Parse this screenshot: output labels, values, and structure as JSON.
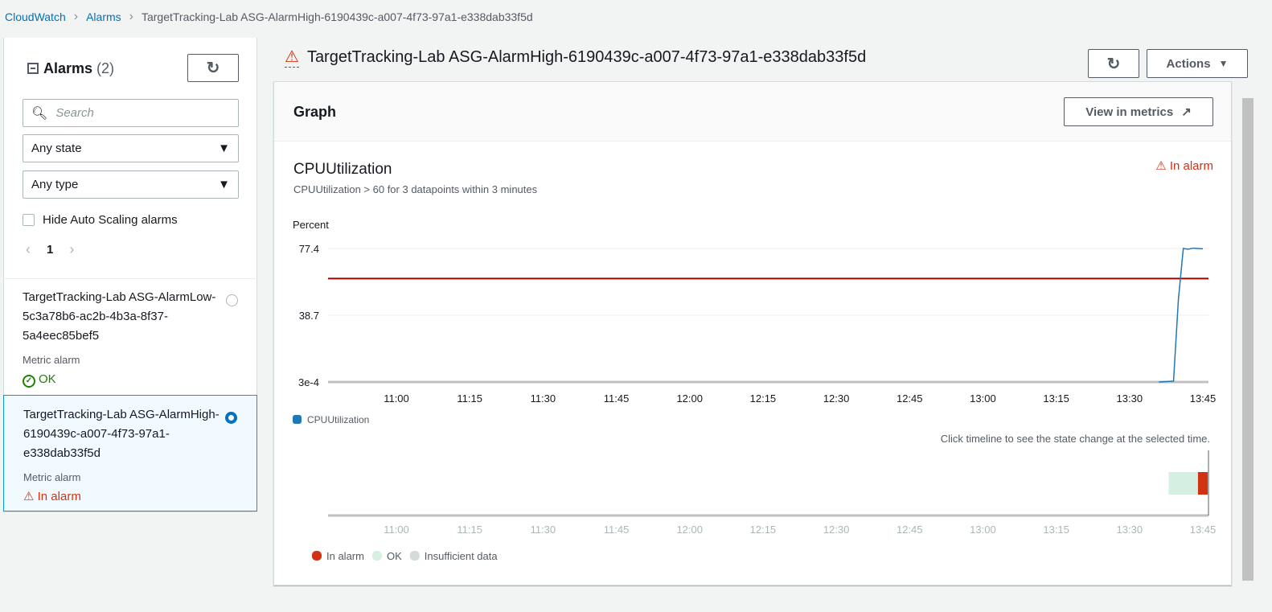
{
  "breadcrumb": [
    "CloudWatch",
    "Alarms",
    "TargetTracking-Lab ASG-AlarmHigh-6190439c-a007-4f73-97a1-e338dab33f5d"
  ],
  "sidebar": {
    "title": "Alarms",
    "count": "(2)",
    "search_placeholder": "Search",
    "state_filter": "Any state",
    "type_filter": "Any type",
    "hide_asg_label": "Hide Auto Scaling alarms",
    "page": "1",
    "items": [
      {
        "name": "TargetTracking-Lab ASG-AlarmLow-5c3a78b6-ac2b-4b3a-8f37-5a4eec85bef5",
        "type": "Metric alarm",
        "state": "OK",
        "selected": false
      },
      {
        "name": "TargetTracking-Lab ASG-AlarmHigh-6190439c-a007-4f73-97a1-e338dab33f5d",
        "type": "Metric alarm",
        "state": "In alarm",
        "selected": true
      }
    ]
  },
  "detail": {
    "title": "TargetTracking-Lab ASG-AlarmHigh-6190439c-a007-4f73-97a1-e338dab33f5d",
    "actions_label": "Actions",
    "graph_title": "Graph",
    "view_metrics_label": "View in metrics",
    "metric_name": "CPUUtilization",
    "condition": "CPUUtilization > 60 for 3 datapoints within 3 minutes",
    "state": "In alarm",
    "timeline_hint": "Click timeline to see the state change at the selected time."
  },
  "colors": {
    "accent": "#0073bb",
    "alarm": "#d13212",
    "ok": "#d5f0e2",
    "insufficient": "#d5dbdb",
    "series": "#1f77b4",
    "threshold": "#a00000"
  },
  "chart_data": {
    "type": "line",
    "ylabel": "Percent",
    "yticks": [
      "3e-4",
      "38.7",
      "77.4"
    ],
    "ylim": [
      0.0003,
      77.4
    ],
    "xticks": [
      "11:00",
      "11:15",
      "11:30",
      "11:45",
      "12:00",
      "12:15",
      "12:30",
      "12:45",
      "13:00",
      "13:15",
      "13:30",
      "13:45"
    ],
    "series": [
      {
        "name": "CPUUtilization",
        "x": [
          "13:36",
          "13:39",
          "13:40",
          "13:41",
          "13:42",
          "13:43",
          "13:45"
        ],
        "values": [
          0.0003,
          0.5,
          48,
          77.4,
          77,
          77.6,
          77.2
        ]
      }
    ],
    "threshold": 60,
    "timeline": {
      "legend": [
        "In alarm",
        "OK",
        "Insufficient data"
      ],
      "segments": [
        {
          "state": "OK",
          "from": "13:38",
          "to": "13:44"
        },
        {
          "state": "In alarm",
          "from": "13:44",
          "to": "13:46"
        }
      ]
    }
  }
}
